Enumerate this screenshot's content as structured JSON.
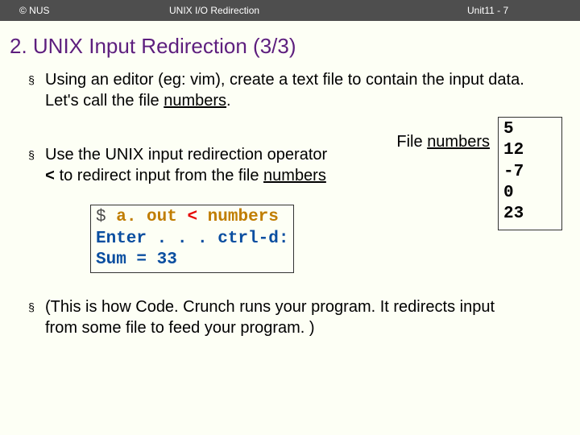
{
  "header": {
    "left": "© NUS",
    "middle": "UNIX I/O Redirection",
    "right": "Unit11 - 7"
  },
  "title": "2. UNIX Input Redirection (3/3)",
  "bullet_marker": "§",
  "b1": {
    "pre": "Using an editor (eg: vim), create a text file to contain the input data. Let's call the file ",
    "file": "numbers",
    "post": "."
  },
  "file_label_pre": "File ",
  "file_label_name": "numbers",
  "file_contents": [
    "5",
    "12",
    "-7",
    "0",
    "23"
  ],
  "b2": {
    "l1": "Use the UNIX input redirection operator",
    "op": "<",
    "mid": " to redirect input from the file ",
    "file": "numbers"
  },
  "code": {
    "prompt": "$ ",
    "cmd1": "a. out ",
    "op": "< ",
    "cmd2": "numbers",
    "out1": "Enter . . . ctrl-d:",
    "out2": "Sum = 33"
  },
  "b3": "(This is how Code. Crunch runs your program. It redirects input from some file to feed your program. )"
}
